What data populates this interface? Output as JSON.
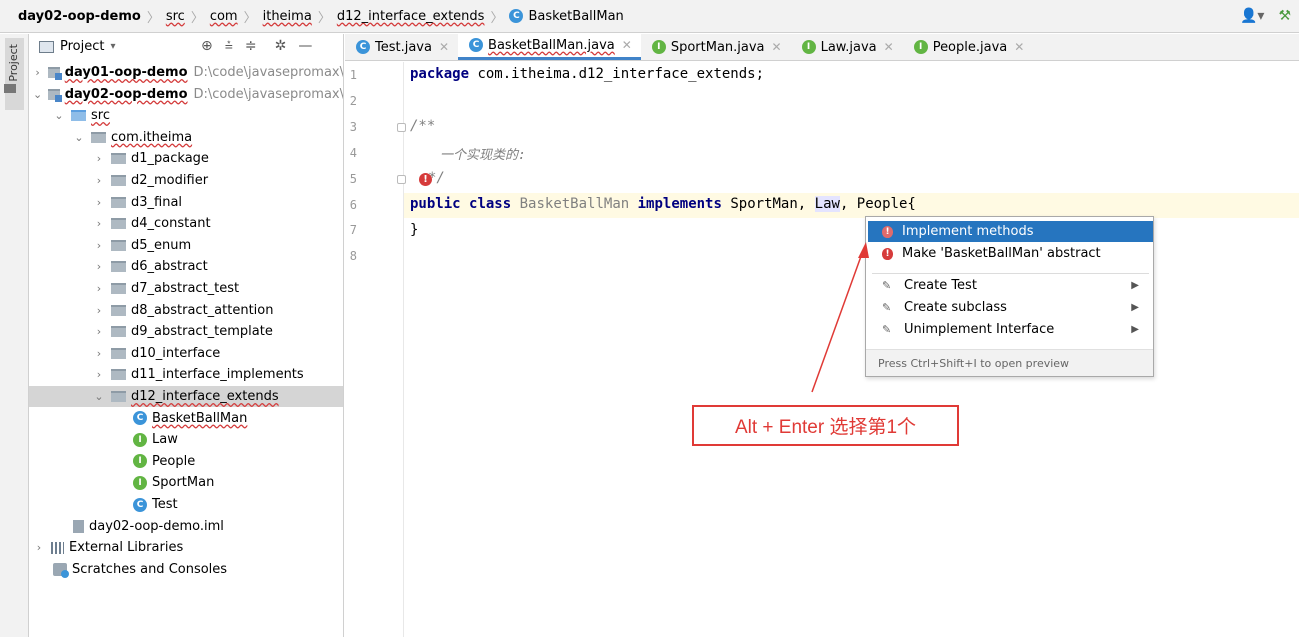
{
  "navbar": {
    "crumbs": [
      "day02-oop-demo",
      "src",
      "com",
      "itheima",
      "d12_interface_extends",
      "BasketBallMan"
    ],
    "right_icons": [
      "user-menu-icon",
      "hammer-icon"
    ]
  },
  "stripe": {
    "label": "Project"
  },
  "panel": {
    "title": "Project",
    "title_suffix": "▾",
    "tools": [
      "target-icon",
      "collapse-all-icon",
      "expand-all-icon",
      "gear-icon",
      "hide-icon"
    ],
    "tree": [
      {
        "arrow": "›",
        "icon": "module-folder",
        "name": "day01-oop-demo",
        "path": "D:\\code\\javasepromax\\",
        "bold": true
      },
      {
        "arrow": "⌄",
        "icon": "module-folder",
        "name": "day02-oop-demo",
        "path": "D:\\code\\javasepromax\\",
        "bold": true
      },
      {
        "arrow": "⌄",
        "icon": "source-folder",
        "name": "src"
      },
      {
        "arrow": "⌄",
        "icon": "package-folder",
        "name": "com.itheima"
      },
      {
        "arrow": "›",
        "icon": "package-folder",
        "name": "d1_package"
      },
      {
        "arrow": "›",
        "icon": "package-folder",
        "name": "d2_modifier"
      },
      {
        "arrow": "›",
        "icon": "package-folder",
        "name": "d3_final"
      },
      {
        "arrow": "›",
        "icon": "package-folder",
        "name": "d4_constant"
      },
      {
        "arrow": "›",
        "icon": "package-folder",
        "name": "d5_enum"
      },
      {
        "arrow": "›",
        "icon": "package-folder",
        "name": "d6_abstract"
      },
      {
        "arrow": "›",
        "icon": "package-folder",
        "name": "d7_abstract_test"
      },
      {
        "arrow": "›",
        "icon": "package-folder",
        "name": "d8_abstract_attention"
      },
      {
        "arrow": "›",
        "icon": "package-folder",
        "name": "d9_abstract_template"
      },
      {
        "arrow": "›",
        "icon": "package-folder",
        "name": "d10_interface"
      },
      {
        "arrow": "›",
        "icon": "package-folder",
        "name": "d11_interface_implements"
      },
      {
        "arrow": "⌄",
        "icon": "package-folder",
        "name": "d12_interface_extends",
        "selected": true
      },
      {
        "arrow": "",
        "icon": "class",
        "name": "BasketBallMan"
      },
      {
        "arrow": "",
        "icon": "interface",
        "name": "Law"
      },
      {
        "arrow": "",
        "icon": "interface",
        "name": "People"
      },
      {
        "arrow": "",
        "icon": "interface",
        "name": "SportMan"
      },
      {
        "arrow": "",
        "icon": "runnable-class",
        "name": "Test"
      },
      {
        "arrow": "",
        "icon": "iml-file",
        "name": "day02-oop-demo.iml"
      },
      {
        "arrow": "›",
        "icon": "library",
        "name": "External Libraries"
      },
      {
        "arrow": "",
        "icon": "scratches",
        "name": "Scratches and Consoles"
      }
    ]
  },
  "tabs": [
    {
      "icon": "class",
      "label": "Test.java"
    },
    {
      "icon": "class",
      "label": "BasketBallMan.java",
      "active": true
    },
    {
      "icon": "interface",
      "label": "SportMan.java"
    },
    {
      "icon": "interface",
      "label": "Law.java"
    },
    {
      "icon": "interface",
      "label": "People.java"
    }
  ],
  "editor": {
    "line_numbers": [
      "1",
      "2",
      "3",
      "4",
      "5",
      "6",
      "7",
      "8"
    ],
    "line1": {
      "kw": "package",
      "rest": " com.itheima.d12_interface_extends;"
    },
    "line3": "/**",
    "line4": "一个实现类的:",
    "line5": "*/",
    "line6": {
      "kw1": "public",
      "kw2": "class",
      "cls": "BasketBallMan",
      "kw3": "implements",
      "t1": " SportMan, ",
      "law": "Law",
      "t2": ", ",
      "people": "People",
      "t3": "{"
    },
    "line7": "}"
  },
  "popup": {
    "items": [
      {
        "icon": "error-bulb",
        "label": "Implement methods",
        "selected": true
      },
      {
        "icon": "error-bulb",
        "label": "Make 'BasketBallMan' abstract"
      },
      {
        "icon": "pen",
        "label": "Create Test",
        "submenu": true
      },
      {
        "icon": "pen",
        "label": "Create subclass",
        "submenu": true
      },
      {
        "icon": "pen",
        "label": "Unimplement Interface",
        "submenu": true
      }
    ],
    "footer": "Press Ctrl+Shift+I to open preview"
  },
  "annotation": {
    "text": "Alt + Enter 选择第1个",
    "color": "#e03a36"
  },
  "colors": {
    "accent": "#2675bf",
    "keyword": "#000080",
    "error": "#d63b3b"
  }
}
